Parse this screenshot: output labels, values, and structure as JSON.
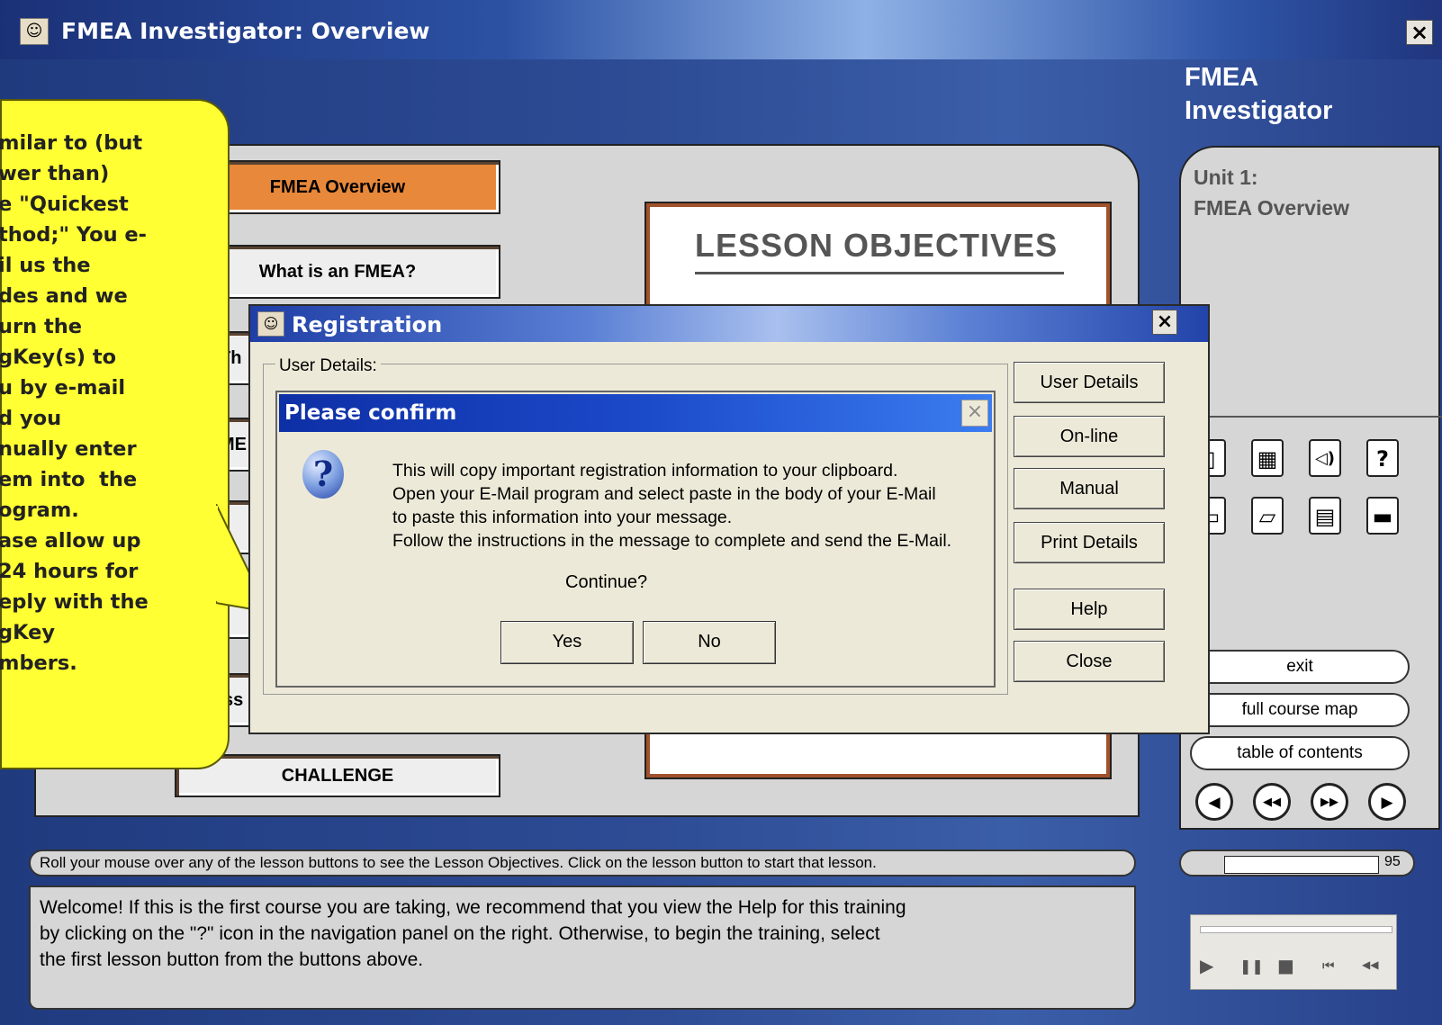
{
  "window": {
    "title": "FMEA Investigator: Overview",
    "close_glyph": "×"
  },
  "brand": {
    "line1": "FMEA",
    "line2": "Investigator"
  },
  "lessons": {
    "fmea_overview": "FMEA Overview",
    "what_is": "What is an FMEA?",
    "partial_th": "Th",
    "partial_me": "ME",
    "partial_ss": "ss",
    "challenge": "CHALLENGE"
  },
  "objectives": {
    "title": "LESSON OBJECTIVES"
  },
  "unit": {
    "line1": "Unit 1:",
    "line2": "FMEA Overview"
  },
  "nav_icons": [
    "book-icon",
    "calculator-icon",
    "speaker-icon",
    "help-icon",
    "folder-icon",
    "folder-open-icon",
    "document-icon",
    "printer-icon"
  ],
  "nav_glyphs": {
    "book": "▯",
    "calc": "▦",
    "speaker": "◁)",
    "help": "?",
    "folder": "▭",
    "folder_open": "▱",
    "doc": "▤",
    "print": "▬"
  },
  "nav_buttons": {
    "exit": "exit",
    "course_map": "full course map",
    "toc": "table of contents"
  },
  "nav_arrows": {
    "prev": "◀",
    "rewind": "◀◀",
    "ffwd": "▶▶",
    "next": "▶"
  },
  "progress": {
    "value": 95,
    "label": "95"
  },
  "status_text": "Roll your mouse over any of the lesson buttons to see the Lesson Objectives.  Click on the lesson button to start that lesson.",
  "welcome_lines": [
    "Welcome!  If this is the first course you are taking, we recommend that you view the Help for this training",
    "by clicking on the \"?\" icon in the navigation panel on the right.  Otherwise, to begin the training, select",
    "the first lesson button from the buttons above."
  ],
  "player": {
    "play": "▶",
    "pause": "❚❚",
    "stop": "■",
    "skip_back": "⏮",
    "rewind": "◀◀"
  },
  "callout_text": "milar to (but\nwer than)\ne \"Quickest\nthod;\" You e-\nil us the\ndes and we\nurn the\ngKey(s) to\nu by e-mail\nd you\nnually enter\nem into  the\nogram.\nase allow up\n24 hours for\neply with the\ngKey\nmbers.",
  "registration": {
    "title": "Registration",
    "close_glyph": "×",
    "group_label": "User Details:",
    "buttons": [
      "User Details",
      "On-line",
      "Manual",
      "Print Details",
      "Help",
      "Close"
    ]
  },
  "confirm": {
    "title": "Please confirm",
    "close_glyph": "×",
    "icon_glyph": "?",
    "message": "This will copy important registration information to your clipboard.\nOpen your E-Mail program and select paste in the body of your E-Mail\nto paste this information into your message.\nFollow the instructions in the message to complete and send the E-Mail.",
    "question": "Continue?",
    "yes": "Yes",
    "no": "No"
  }
}
